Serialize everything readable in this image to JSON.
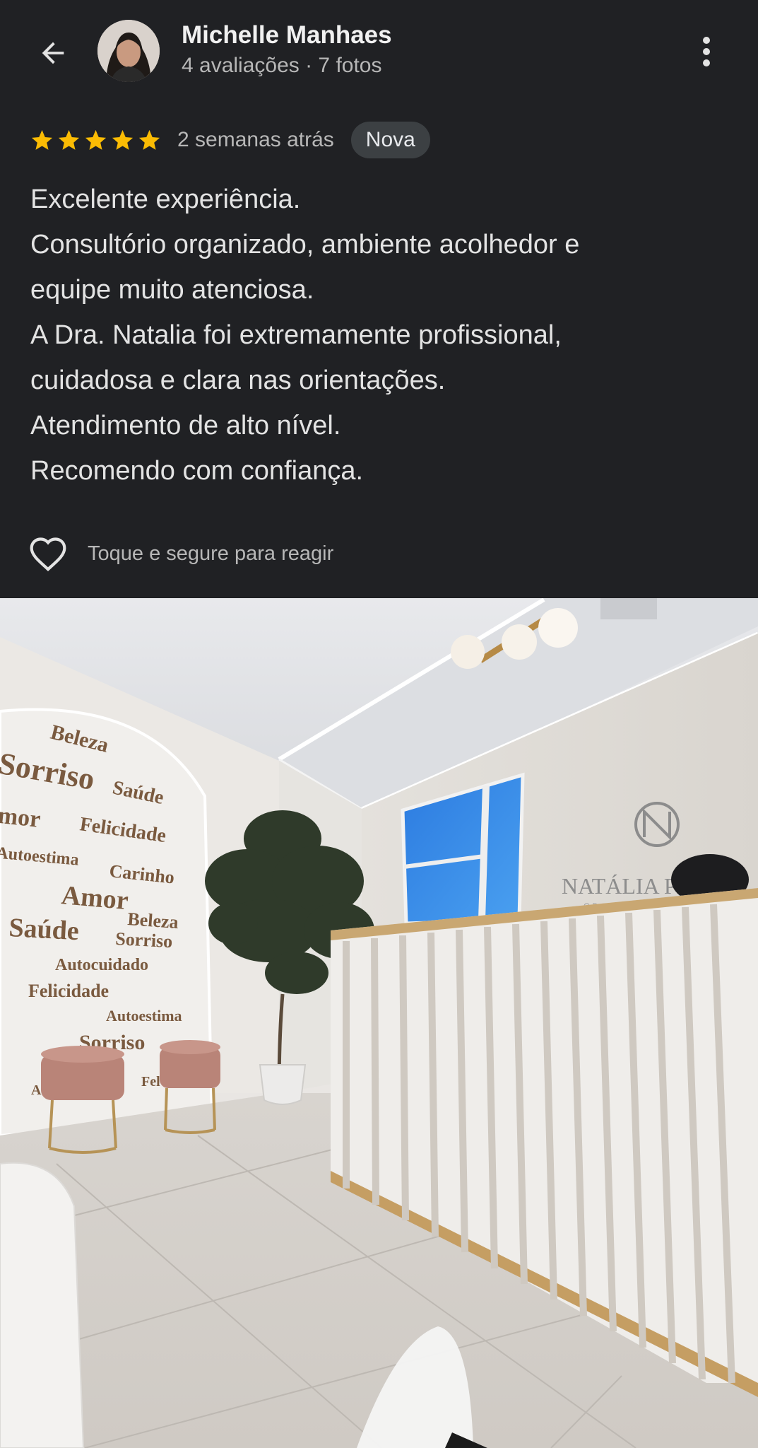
{
  "header": {
    "user_name": "Michelle Manhaes",
    "user_meta": "4 avaliações · 7 fotos"
  },
  "review": {
    "rating": 5,
    "max_rating": 5,
    "time_ago": "2 semanas atrás",
    "badge": "Nova",
    "lines": [
      "Excelente experiência.",
      "Consultório organizado, ambiente acolhedor e",
      "equipe muito atenciosa.",
      "A Dra. Natalia foi extremamente profissional,",
      "cuidadosa e clara nas orientações.",
      "Atendimento de alto nível.",
      "Recomendo com confiança."
    ],
    "react_hint": "Toque e segure para reagir"
  },
  "photo": {
    "wall_words": [
      "Beleza",
      "Sorriso",
      "Saúde",
      "mor",
      "Felicidade",
      "Autoestima",
      "Carinho",
      "Amor",
      "Saúde",
      "Beleza",
      "Sorriso",
      "Autocuidado",
      "Felicidade",
      "Autoestima",
      "Sorriso",
      "Fel",
      "Au"
    ],
    "sign_name": "NATÁLIA PR",
    "sign_sub": "ODONTOLOGIA"
  },
  "colors": {
    "background": "#202124",
    "star": "#fbbc04",
    "badge_bg": "#3c4043"
  }
}
